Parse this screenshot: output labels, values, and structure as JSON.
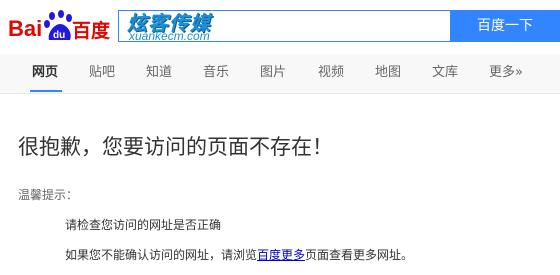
{
  "logo": {
    "part1": "Bai",
    "paw_text": "du",
    "part3": "百度"
  },
  "search": {
    "value_main": "炫客传媒",
    "value_sub": "xuankecm.com",
    "button_label": "百度一下"
  },
  "nav": {
    "items": [
      "网页",
      "贴吧",
      "知道",
      "音乐",
      "图片",
      "视频",
      "地图",
      "文库",
      "更多»"
    ],
    "active_index": 0
  },
  "error": {
    "title": "很抱歉，您要访问的页面不存在！",
    "tips_label": "温馨提示：",
    "tip1": "请检查您访问的网址是否正确",
    "tip2_before": "如果您不能确认访问的网址，请浏览",
    "tip2_link": "百度更多",
    "tip2_after": "页面查看更多网址。"
  },
  "colors": {
    "accent": "#3385ff",
    "logo_red": "#e10602",
    "logo_blue": "#2319dc",
    "link": "#0000cc"
  }
}
